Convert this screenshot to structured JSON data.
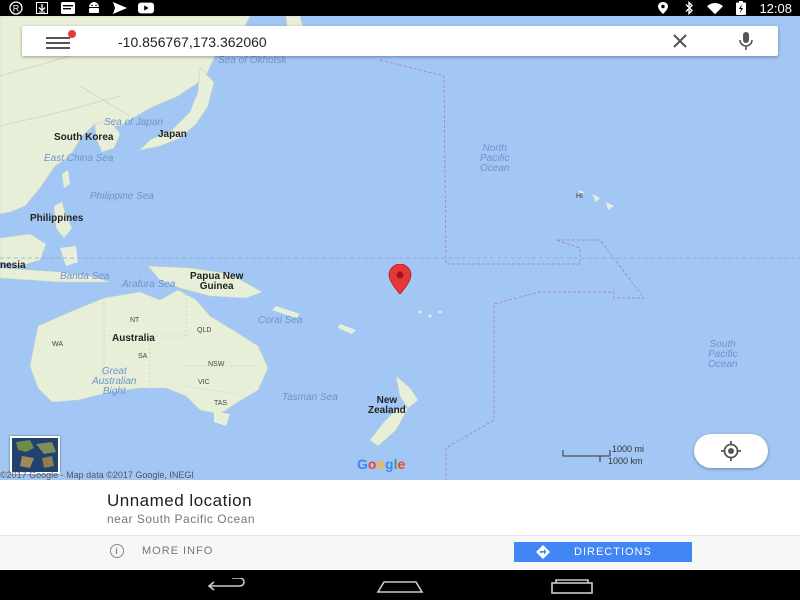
{
  "status_bar": {
    "time": "12:08",
    "left_icons": [
      "registered-icon",
      "download-icon",
      "message-icon",
      "android-icon",
      "send-icon",
      "youtube-icon"
    ],
    "right_icons": [
      "location-icon",
      "bluetooth-icon",
      "wifi-icon",
      "battery-charging-icon"
    ]
  },
  "search": {
    "value": "-10.856767,173.362060"
  },
  "map": {
    "labels": {
      "sea_of_okhotsk": "Sea of\nOkhotsk",
      "sea_of_japan": "Sea of Japan",
      "south_korea": "South Korea",
      "japan": "Japan",
      "east_china_sea": "East China Sea",
      "north_pacific_ocean": "North\nPacific\nOcean",
      "hi": "HI",
      "philippine_sea": "Philippine Sea",
      "philippines": "Philippines",
      "indonesia": "nesia",
      "banda_sea": "Banda Sea",
      "arafura_sea": "Arafura Sea",
      "papua_new_guinea": "Papua New\nGuinea",
      "coral_sea": "Coral Sea",
      "nt": "NT",
      "qld": "QLD",
      "wa": "WA",
      "australia": "Australia",
      "sa": "SA",
      "nsw": "NSW",
      "great_australian_bight": "Great\nAustralian\nBight",
      "vic": "VIC",
      "tas": "TAS",
      "tasman_sea": "Tasman Sea",
      "new_zealand": "New\nZealand",
      "south_pacific_ocean": "South\nPacific\nOcean"
    },
    "google_logo": [
      "G",
      "o",
      "o",
      "g",
      "l",
      "e"
    ],
    "scale_mi": "1000 mi",
    "scale_km": "1000 km",
    "attribution": "©2017 Google - Map data ©2017 Google, INEGI"
  },
  "place": {
    "title": "Unnamed location",
    "subtitle": "near South Pacific Ocean",
    "more_info": "MORE INFO",
    "directions": "DIRECTIONS"
  },
  "colors": {
    "ocean": "#a3c7f4",
    "land": "#e8efd9",
    "pin": "#e53935",
    "accent": "#4285f4"
  }
}
